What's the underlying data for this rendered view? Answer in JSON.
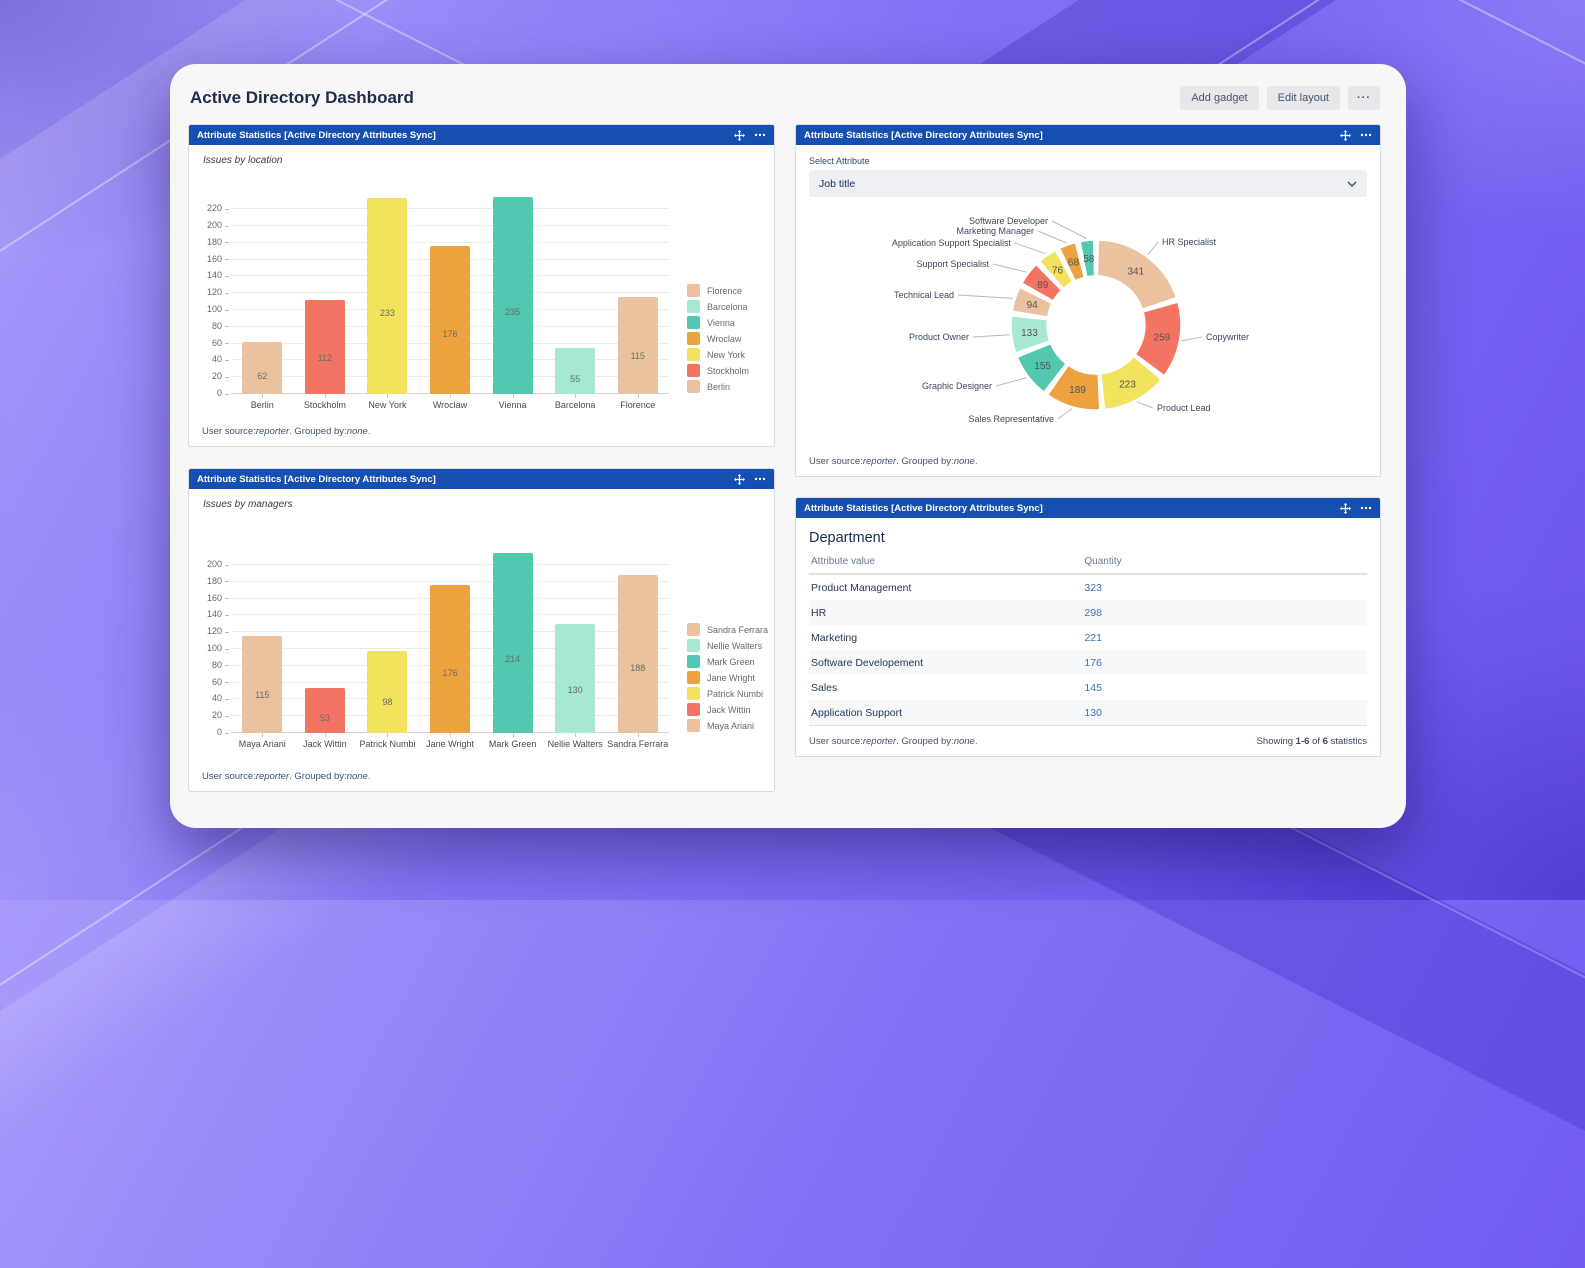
{
  "page": {
    "title": "Active Directory Dashboard",
    "actions": {
      "add_gadget": "Add gadget",
      "edit_layout": "Edit layout",
      "more": "···"
    }
  },
  "shared": {
    "gadget_title": "Attribute Statistics [Active Directory Attributes Sync]",
    "footer": {
      "label": "User source:",
      "source": "reporter",
      "mid": ". Grouped by:",
      "group": "none",
      "end": "."
    }
  },
  "palette": {
    "tan": "#eac2a0",
    "salmon": "#f37463",
    "yellow": "#f2e25e",
    "orange": "#eba23f",
    "teal": "#53c8b0",
    "mint": "#a7e8d4",
    "header_blue": "#1550b0",
    "link_blue": "#3f72b4"
  },
  "select_attribute": {
    "label": "Select Attribute",
    "value": "Job title"
  },
  "table": {
    "heading": "Department",
    "columns": [
      "Attribute value",
      "Quantity"
    ],
    "rows": [
      {
        "attribute": "Product Management",
        "quantity": "323"
      },
      {
        "attribute": "HR",
        "quantity": "298"
      },
      {
        "attribute": "Marketing",
        "quantity": "221"
      },
      {
        "attribute": "Software Developement",
        "quantity": "176"
      },
      {
        "attribute": "Sales",
        "quantity": "145"
      },
      {
        "attribute": "Application Support",
        "quantity": "130"
      }
    ],
    "showing": {
      "prefix": "Showing",
      "range": "1-6",
      "of": "of",
      "total": "6",
      "suffix": "statistics"
    }
  },
  "chart_data": [
    {
      "type": "bar",
      "title": "Issues by location",
      "categories": [
        "Berlin",
        "Stockholm",
        "New York",
        "Wroclaw",
        "Vienna",
        "Barcelona",
        "Florence"
      ],
      "values": [
        62,
        112,
        233,
        176,
        235,
        55,
        115
      ],
      "colors": [
        "tan",
        "salmon",
        "yellow",
        "orange",
        "teal",
        "mint",
        "tan"
      ],
      "ylim": [
        0,
        240
      ],
      "yticks": [
        0,
        20,
        40,
        60,
        80,
        100,
        120,
        140,
        160,
        180,
        200,
        220
      ],
      "grid": true,
      "legend_position": "right",
      "legend": [
        {
          "label": "Florence",
          "color": "tan"
        },
        {
          "label": "Barcelona",
          "color": "mint"
        },
        {
          "label": "Vienna",
          "color": "teal"
        },
        {
          "label": "Wroclaw",
          "color": "orange"
        },
        {
          "label": "New York",
          "color": "yellow"
        },
        {
          "label": "Stockholm",
          "color": "salmon"
        },
        {
          "label": "Berlin",
          "color": "tan"
        }
      ]
    },
    {
      "type": "bar",
      "title": "Issues by managers",
      "categories": [
        "Maya Ariani",
        "Jack Wittin",
        "Patrick Numbi",
        "Jane Wright",
        "Mark Green",
        "Nellie Walters",
        "Sandra Ferrara"
      ],
      "values": [
        115,
        53,
        98,
        176,
        214,
        130,
        188
      ],
      "colors": [
        "tan",
        "salmon",
        "yellow",
        "orange",
        "teal",
        "mint",
        "tan"
      ],
      "ylim": [
        0,
        230
      ],
      "yticks": [
        0,
        20,
        40,
        60,
        80,
        100,
        120,
        140,
        160,
        180,
        200
      ],
      "grid": true,
      "legend_position": "right",
      "legend": [
        {
          "label": "Sandra Ferrara",
          "color": "tan"
        },
        {
          "label": "Nellie Walters",
          "color": "mint"
        },
        {
          "label": "Mark Green",
          "color": "teal"
        },
        {
          "label": "Jane Wright",
          "color": "orange"
        },
        {
          "label": "Patrick Numbi",
          "color": "yellow"
        },
        {
          "label": "Jack Wittin",
          "color": "salmon"
        },
        {
          "label": "Maya Ariani",
          "color": "tan"
        }
      ]
    },
    {
      "type": "pie",
      "style": "donut",
      "title": "Job title",
      "slices": [
        {
          "label": "HR Specialist",
          "value": 341,
          "color": "tan"
        },
        {
          "label": "Copywriter",
          "value": 259,
          "color": "salmon"
        },
        {
          "label": "Product Lead",
          "value": 223,
          "color": "yellow"
        },
        {
          "label": "Sales Representative",
          "value": 189,
          "color": "orange"
        },
        {
          "label": "Graphic Designer",
          "value": 155,
          "color": "teal"
        },
        {
          "label": "Product Owner",
          "value": 133,
          "color": "mint"
        },
        {
          "label": "Technical Lead",
          "value": 94,
          "color": "tan"
        },
        {
          "label": "Support Specialist",
          "value": 89,
          "color": "salmon"
        },
        {
          "label": "Application Support Specialist",
          "value": 76,
          "color": "yellow"
        },
        {
          "label": "Marketing Manager",
          "value": 68,
          "color": "orange"
        },
        {
          "label": "Software Developer",
          "value": 58,
          "color": "teal"
        }
      ]
    }
  ]
}
